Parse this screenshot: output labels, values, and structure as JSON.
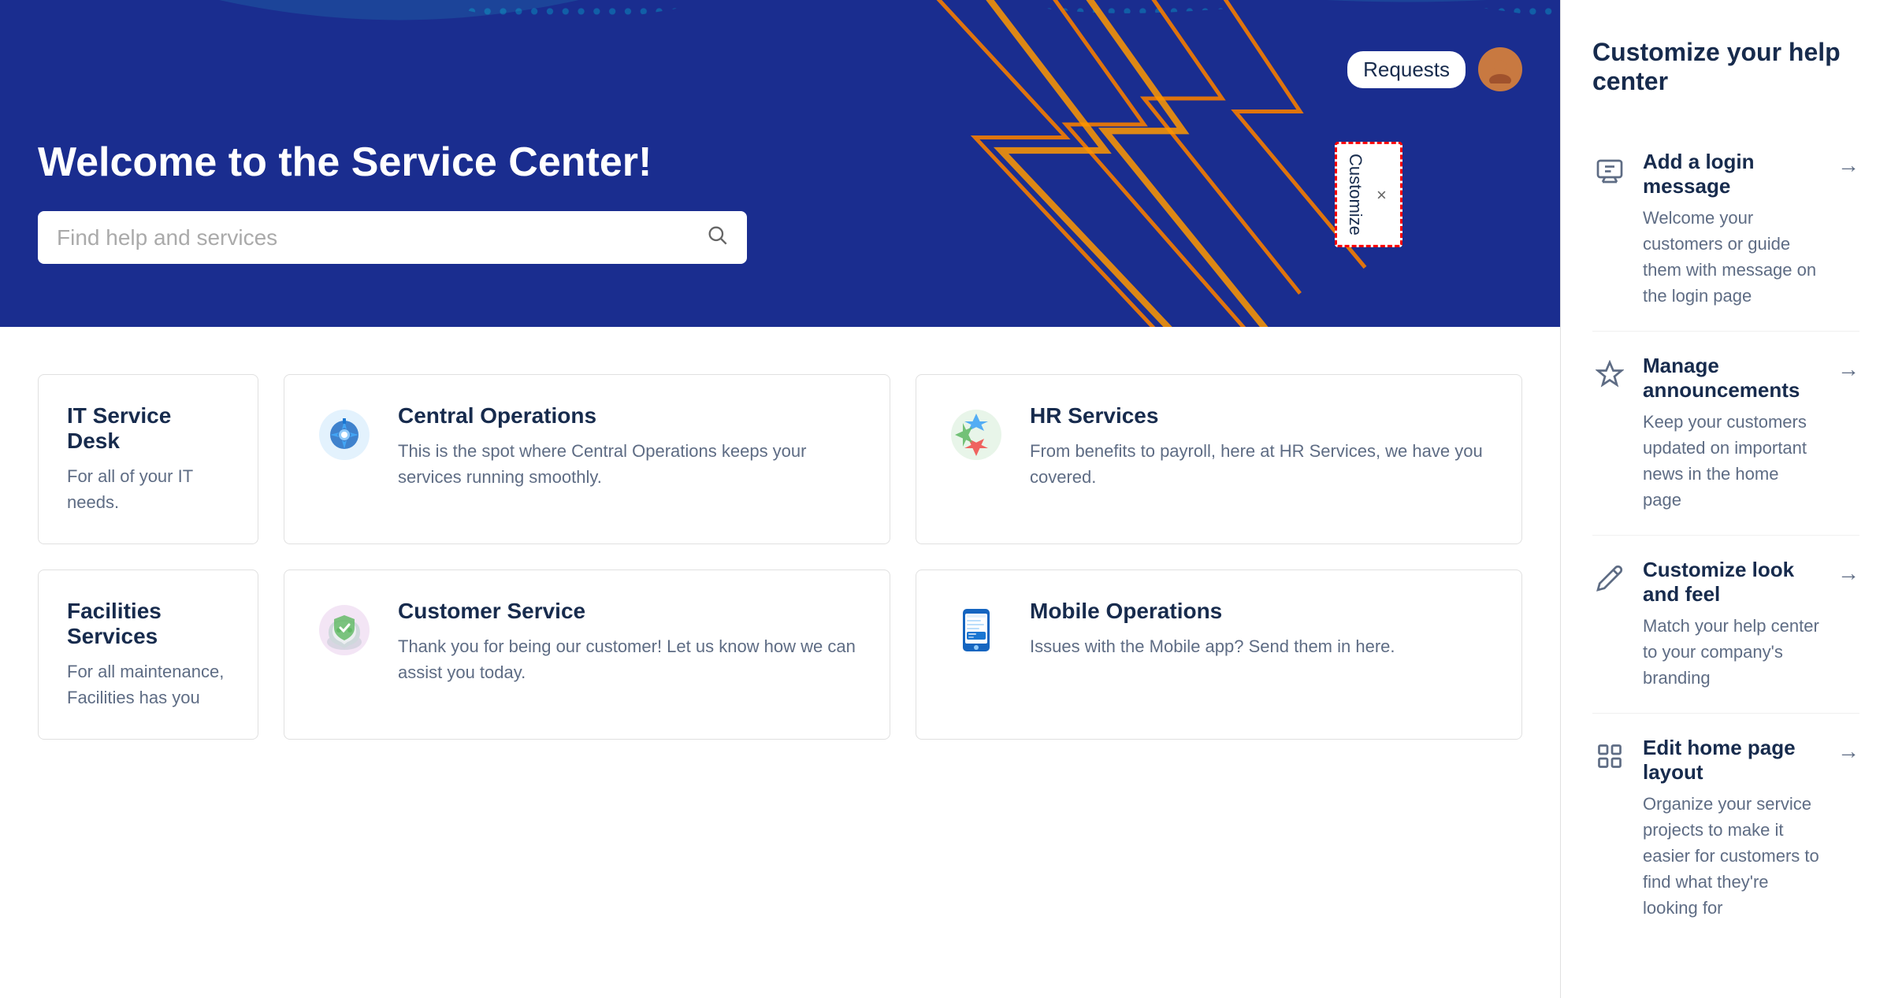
{
  "hero": {
    "title": "Welcome to the Service Center!",
    "search_placeholder": "Find help and services",
    "nav": {
      "requests_label": "Requests"
    }
  },
  "customize_tab": {
    "label": "Customize",
    "close": "×"
  },
  "cards_row1": [
    {
      "id": "it-service-desk",
      "title": "IT Service Desk",
      "description": "For all of your IT needs.",
      "icon": "🖥️",
      "partial": true
    },
    {
      "id": "central-operations",
      "title": "Central Operations",
      "description": "This is the spot where Central Operations keeps your services running smoothly.",
      "icon": "⚙️"
    },
    {
      "id": "hr-services",
      "title": "HR Services",
      "description": "From benefits to payroll, here at HR Services, we have you covered.",
      "icon": "👤"
    }
  ],
  "cards_row2": [
    {
      "id": "facilities-services",
      "title": "Facilities Services",
      "description": "For all maintenance, Facilities has you",
      "icon": "🏢",
      "partial": true
    },
    {
      "id": "customer-service",
      "title": "Customer Service",
      "description": "Thank you for being our customer! Let us know how we can assist you today.",
      "icon": "🛡️"
    },
    {
      "id": "mobile-operations",
      "title": "Mobile Operations",
      "description": "Issues with the Mobile app? Send them in here.",
      "icon": "📱"
    }
  ],
  "right_panel": {
    "title": "Customize your help center",
    "items": [
      {
        "id": "add-login-message",
        "title": "Add a login message",
        "description": "Welcome your customers or guide them with message on the login page",
        "icon": "message"
      },
      {
        "id": "manage-announcements",
        "title": "Manage announcements",
        "description": "Keep your customers updated on important news in the home page",
        "icon": "pin"
      },
      {
        "id": "customize-look-feel",
        "title": "Customize look and feel",
        "description": "Match your help center to your company's branding",
        "icon": "pencil"
      },
      {
        "id": "edit-home-page-layout",
        "title": "Edit home page layout",
        "description": "Organize your service projects to make it easier for customers to find what they're looking for",
        "icon": "grid"
      }
    ]
  }
}
